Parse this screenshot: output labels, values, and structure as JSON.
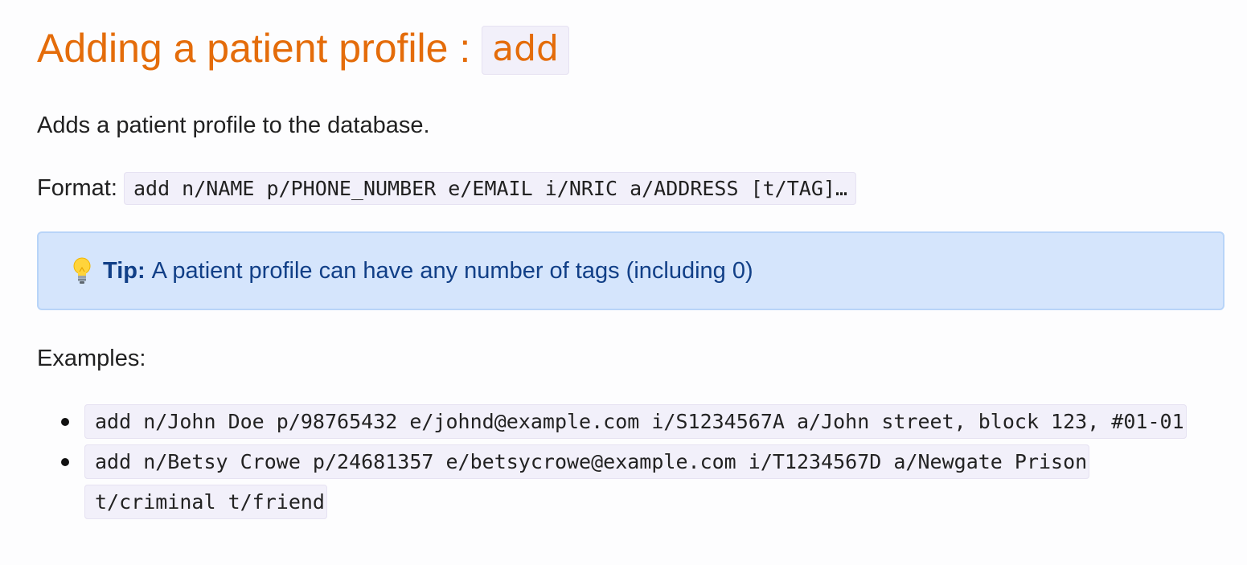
{
  "heading": {
    "text": "Adding a patient profile : ",
    "command": "add"
  },
  "description": "Adds a patient profile to the database.",
  "format": {
    "label": "Format: ",
    "code": "add n/NAME p/PHONE_NUMBER e/EMAIL i/NRIC a/ADDRESS [t/TAG]…"
  },
  "tip": {
    "icon": "lightbulb-icon",
    "label": "Tip:",
    "text": "A patient profile can have any number of tags (including 0)"
  },
  "examples": {
    "label": "Examples:",
    "items": [
      "add n/John Doe p/98765432 e/johnd@example.com i/S1234567A a/John street, block 123, #01-01",
      "add n/Betsy Crowe p/24681357 e/betsycrowe@example.com i/T1234567D a/Newgate Prison t/criminal t/friend"
    ]
  },
  "colors": {
    "heading": "#e46c0a",
    "tip_background": "#d5e5fc",
    "tip_text": "#113f87",
    "code_background": "#f2f0fa"
  }
}
